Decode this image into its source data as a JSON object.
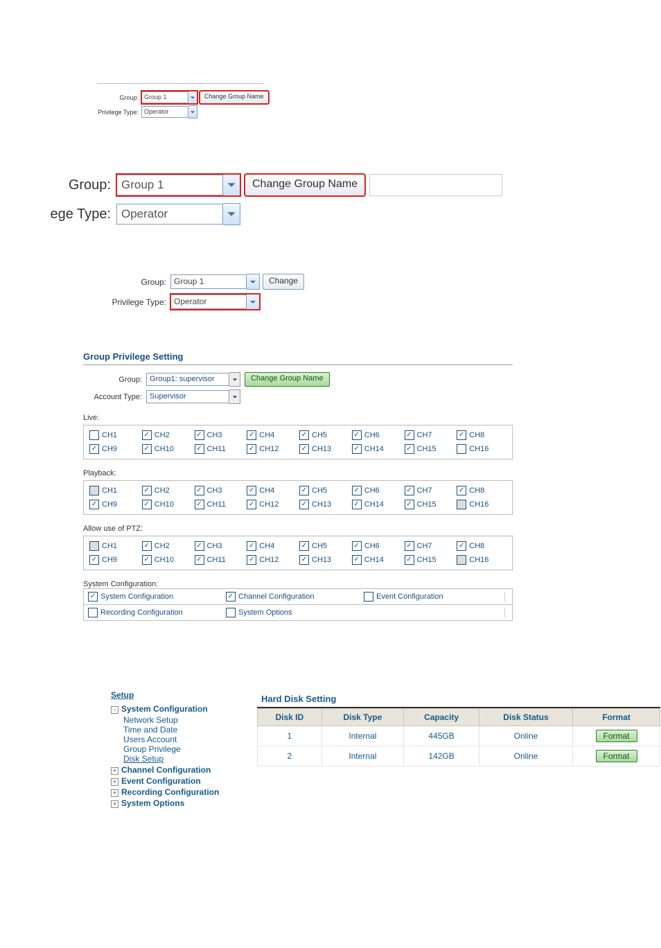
{
  "fig1": {
    "group_label": "Group:",
    "group_value": "Group 1",
    "priv_label": "Privilege Type:",
    "priv_value": "Operator",
    "change_btn": "Change Group Name"
  },
  "fig2": {
    "group_label": "Group:",
    "group_value": "Group 1",
    "type_label": "ege Type:",
    "type_value": "Operator",
    "change_btn": "Change Group Name"
  },
  "fig3": {
    "group_label": "Group:",
    "group_value": "Group 1",
    "priv_label": "Privilege Type:",
    "priv_value": "Operator",
    "change_btn": "Change"
  },
  "fig4": {
    "title": "Group Privilege Setting",
    "group_label": "Group:",
    "group_value": "Group1: supervisor",
    "acct_label": "Account Type:",
    "acct_value": "Supervisor",
    "change_btn": "Change Group Name",
    "sections": {
      "live": {
        "label": "Live:",
        "cells": [
          {
            "t": "CH1",
            "c": false,
            "g": false
          },
          {
            "t": "CH2",
            "c": true,
            "g": false
          },
          {
            "t": "CH3",
            "c": true,
            "g": false
          },
          {
            "t": "CH4",
            "c": true,
            "g": false
          },
          {
            "t": "CH5",
            "c": true,
            "g": false
          },
          {
            "t": "CH6",
            "c": true,
            "g": false
          },
          {
            "t": "CH7",
            "c": true,
            "g": false
          },
          {
            "t": "CH8",
            "c": true,
            "g": false
          },
          {
            "t": "CH9",
            "c": true,
            "g": false
          },
          {
            "t": "CH10",
            "c": true,
            "g": false
          },
          {
            "t": "CH11",
            "c": true,
            "g": false
          },
          {
            "t": "CH12",
            "c": true,
            "g": false
          },
          {
            "t": "CH13",
            "c": true,
            "g": false
          },
          {
            "t": "CH14",
            "c": true,
            "g": false
          },
          {
            "t": "CH15",
            "c": true,
            "g": false
          },
          {
            "t": "CH16",
            "c": false,
            "g": false
          }
        ]
      },
      "playback": {
        "label": "Playback:",
        "cells": [
          {
            "t": "CH1",
            "c": false,
            "g": true
          },
          {
            "t": "CH2",
            "c": true,
            "g": false
          },
          {
            "t": "CH3",
            "c": true,
            "g": false
          },
          {
            "t": "CH4",
            "c": true,
            "g": false
          },
          {
            "t": "CH5",
            "c": true,
            "g": false
          },
          {
            "t": "CH6",
            "c": true,
            "g": false
          },
          {
            "t": "CH7",
            "c": true,
            "g": false
          },
          {
            "t": "CH8",
            "c": true,
            "g": false
          },
          {
            "t": "CH9",
            "c": true,
            "g": false
          },
          {
            "t": "CH10",
            "c": true,
            "g": false
          },
          {
            "t": "CH11",
            "c": true,
            "g": false
          },
          {
            "t": "CH12",
            "c": true,
            "g": false
          },
          {
            "t": "CH13",
            "c": true,
            "g": false
          },
          {
            "t": "CH14",
            "c": true,
            "g": false
          },
          {
            "t": "CH15",
            "c": true,
            "g": false
          },
          {
            "t": "CH16",
            "c": false,
            "g": true
          }
        ]
      },
      "ptz": {
        "label": "Allow use of PTZ:",
        "cells": [
          {
            "t": "CH1",
            "c": false,
            "g": true
          },
          {
            "t": "CH2",
            "c": true,
            "g": false
          },
          {
            "t": "CH3",
            "c": true,
            "g": false
          },
          {
            "t": "CH4",
            "c": true,
            "g": false
          },
          {
            "t": "CH5",
            "c": true,
            "g": false
          },
          {
            "t": "CH6",
            "c": true,
            "g": false
          },
          {
            "t": "CH7",
            "c": true,
            "g": false
          },
          {
            "t": "CH8",
            "c": true,
            "g": false
          },
          {
            "t": "CH9",
            "c": true,
            "g": false
          },
          {
            "t": "CH10",
            "c": true,
            "g": false
          },
          {
            "t": "CH11",
            "c": true,
            "g": false
          },
          {
            "t": "CH12",
            "c": true,
            "g": false
          },
          {
            "t": "CH13",
            "c": true,
            "g": false
          },
          {
            "t": "CH14",
            "c": true,
            "g": false
          },
          {
            "t": "CH15",
            "c": true,
            "g": false
          },
          {
            "t": "CH16",
            "c": false,
            "g": true
          }
        ]
      }
    },
    "syscfg": {
      "label": "System Configuration:",
      "row1": [
        {
          "t": "System Configuration",
          "c": true
        },
        {
          "t": "Channel Configuration",
          "c": true
        },
        {
          "t": "Event Configuration",
          "c": false
        }
      ],
      "row2": [
        {
          "t": "Recording Configuration",
          "c": false
        },
        {
          "t": "System Options",
          "c": false
        },
        {
          "t": "",
          "c": null
        }
      ]
    }
  },
  "fig5": {
    "root": "Setup",
    "nodes": [
      {
        "pm": "-",
        "label": "System Configuration",
        "children": [
          {
            "label": "Network Setup"
          },
          {
            "label": "Time and Date"
          },
          {
            "label": "Users Account"
          },
          {
            "label": "Group Privilege"
          },
          {
            "label": "Disk Setup",
            "current": true
          }
        ]
      },
      {
        "pm": "+",
        "label": "Channel Configuration"
      },
      {
        "pm": "+",
        "label": "Event Configuration"
      },
      {
        "pm": "+",
        "label": "Recording Configuration"
      },
      {
        "pm": "+",
        "label": "System Options"
      }
    ],
    "disk": {
      "title": "Hard Disk Setting",
      "headers": [
        "Disk ID",
        "Disk Type",
        "Capacity",
        "Disk Status",
        "Format"
      ],
      "rows": [
        {
          "id": "1",
          "type": "Internal",
          "cap": "445GB",
          "status": "Online",
          "fmt": "Format"
        },
        {
          "id": "2",
          "type": "Internal",
          "cap": "142GB",
          "status": "Online",
          "fmt": "Format"
        }
      ]
    }
  }
}
